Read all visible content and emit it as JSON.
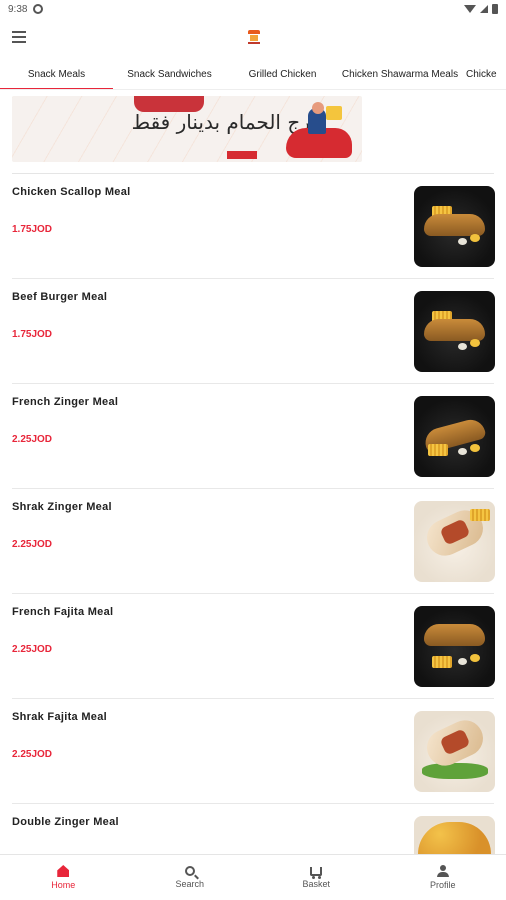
{
  "status_bar": {
    "time": "9:38"
  },
  "tabs": [
    {
      "label": "Snack Meals",
      "active": true
    },
    {
      "label": "Snack Sandwiches",
      "active": false
    },
    {
      "label": "Grilled Chicken",
      "active": false
    },
    {
      "label": "Chicken Shawarma Meals",
      "active": false
    },
    {
      "label": "Chicke",
      "active": false
    }
  ],
  "banner": {
    "text_line": "مرج الحمام بدينار فقط"
  },
  "items": [
    {
      "name": "Chicken Scallop Meal",
      "price": "1.75JOD",
      "image_style": "dark-plate"
    },
    {
      "name": "Beef Burger Meal",
      "price": "1.75JOD",
      "image_style": "dark-plate"
    },
    {
      "name": "French Zinger Meal",
      "price": "2.25JOD",
      "image_style": "dark-plate"
    },
    {
      "name": "Shrak Zinger Meal",
      "price": "2.25JOD",
      "image_style": "light-wrap"
    },
    {
      "name": "French Fajita Meal",
      "price": "2.25JOD",
      "image_style": "dark-plate"
    },
    {
      "name": "Shrak Fajita Meal",
      "price": "2.25JOD",
      "image_style": "light-wrap"
    },
    {
      "name": "Double Zinger Meal",
      "price": "",
      "image_style": "burger"
    }
  ],
  "bottom_nav": [
    {
      "label": "Home",
      "icon": "home-icon",
      "active": true
    },
    {
      "label": "Search",
      "icon": "search-icon",
      "active": false
    },
    {
      "label": "Basket",
      "icon": "cart-icon",
      "active": false
    },
    {
      "label": "Profile",
      "icon": "profile-icon",
      "active": false
    }
  ],
  "colors": {
    "accent": "#e8263a"
  }
}
